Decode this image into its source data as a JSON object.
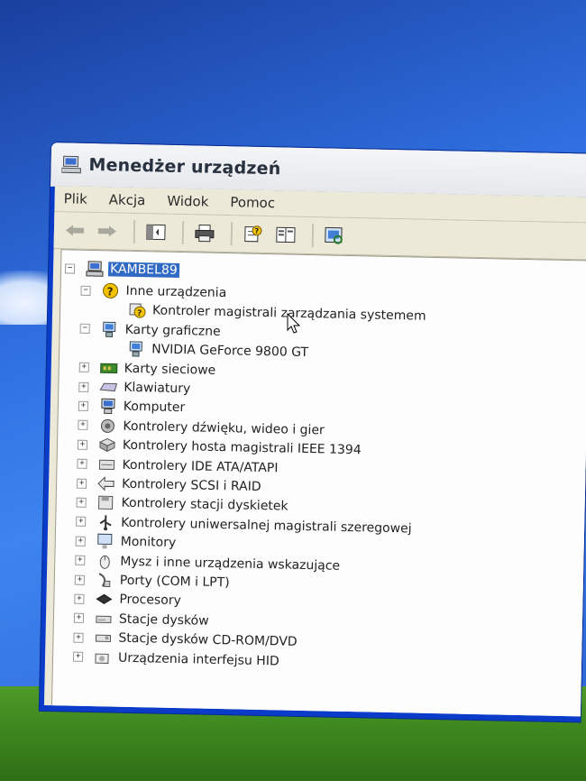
{
  "window": {
    "title": "Menedżer urządzeń",
    "menu": [
      "Plik",
      "Akcja",
      "Widok",
      "Pomoc"
    ],
    "toolbar_icons": [
      "back-arrow-icon",
      "forward-arrow-icon",
      "show-hide-tree-icon",
      "print-icon",
      "help-properties-icon",
      "view-icon",
      "scan-hardware-icon"
    ]
  },
  "tree": {
    "root": "KAMBEL89",
    "items": [
      {
        "label": "Inne urządzenia",
        "expander": "−",
        "icon": "unknown-device-icon",
        "level": 1
      },
      {
        "label": "Kontroler magistrali zarządzania systemem",
        "expander": "",
        "icon": "warning-device-icon",
        "level": 2
      },
      {
        "label": "Karty graficzne",
        "expander": "−",
        "icon": "display-adapter-icon",
        "level": 1
      },
      {
        "label": "NVIDIA GeForce 9800 GT",
        "expander": "",
        "icon": "display-adapter-icon",
        "level": 2
      },
      {
        "label": "Karty sieciowe",
        "expander": "+",
        "icon": "network-card-icon",
        "level": 1
      },
      {
        "label": "Klawiatury",
        "expander": "+",
        "icon": "keyboard-icon",
        "level": 1
      },
      {
        "label": "Komputer",
        "expander": "+",
        "icon": "computer-icon",
        "level": 1
      },
      {
        "label": "Kontrolery dźwięku, wideo i gier",
        "expander": "+",
        "icon": "sound-icon",
        "level": 1
      },
      {
        "label": "Kontrolery hosta magistrali IEEE 1394",
        "expander": "+",
        "icon": "ieee1394-icon",
        "level": 1
      },
      {
        "label": "Kontrolery IDE ATA/ATAPI",
        "expander": "+",
        "icon": "ide-controller-icon",
        "level": 1
      },
      {
        "label": "Kontrolery SCSI i RAID",
        "expander": "+",
        "icon": "scsi-icon",
        "level": 1
      },
      {
        "label": "Kontrolery stacji dyskietek",
        "expander": "+",
        "icon": "floppy-controller-icon",
        "level": 1
      },
      {
        "label": "Kontrolery uniwersalnej magistrali szeregowej",
        "expander": "+",
        "icon": "usb-icon",
        "level": 1
      },
      {
        "label": "Monitory",
        "expander": "+",
        "icon": "monitor-icon",
        "level": 1
      },
      {
        "label": "Mysz i inne urządzenia wskazujące",
        "expander": "+",
        "icon": "mouse-icon",
        "level": 1
      },
      {
        "label": "Porty (COM i LPT)",
        "expander": "+",
        "icon": "port-icon",
        "level": 1
      },
      {
        "label": "Procesory",
        "expander": "+",
        "icon": "processor-icon",
        "level": 1
      },
      {
        "label": "Stacje dysków",
        "expander": "+",
        "icon": "disk-drive-icon",
        "level": 1
      },
      {
        "label": "Stacje dysków CD-ROM/DVD",
        "expander": "+",
        "icon": "cdrom-icon",
        "level": 1
      },
      {
        "label": "Urządzenia interfejsu HID",
        "expander": "+",
        "icon": "hid-icon",
        "level": 1
      }
    ]
  },
  "colors": {
    "selection": "#316ac5",
    "title_blue": "#0a3cc9"
  }
}
